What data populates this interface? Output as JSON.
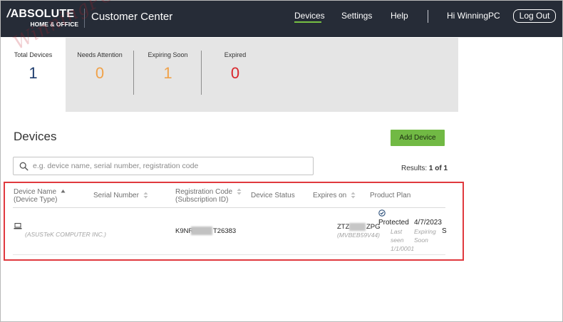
{
  "header": {
    "logo_main": "ABSOLUTE",
    "logo_sub": "HOME & OFFICE",
    "app_title": "Customer Center",
    "nav": {
      "devices": "Devices",
      "settings": "Settings",
      "help": "Help",
      "greeting": "Hi WinningPC",
      "logout": "Log Out"
    },
    "accent_color": "#76c043",
    "bar_color": "#262c37"
  },
  "watermark": "WinningPC",
  "stats": {
    "total": {
      "label": "Total Devices",
      "value": "1",
      "color": "#1f3d6e"
    },
    "needs_attention": {
      "label": "Needs Attention",
      "value": "0",
      "color": "#f0a24a"
    },
    "expiring_soon": {
      "label": "Expiring Soon",
      "value": "1",
      "color": "#f0a24a"
    },
    "expired": {
      "label": "Expired",
      "value": "0",
      "color": "#d9262c"
    }
  },
  "devices": {
    "title": "Devices",
    "add_button": "Add Device",
    "search_placeholder": "e.g. device name, serial number, registration code",
    "results_prefix": "Results: ",
    "results_count": "1 of 1"
  },
  "table": {
    "headers": {
      "device_name": "Device Name",
      "device_type": "(Device Type)",
      "serial_number": "Serial Number",
      "registration_code": "Registration Code",
      "subscription_id": "(Subscription ID)",
      "device_status": "Device Status",
      "expires_on": "Expires on",
      "product_plan": "Product Plan"
    },
    "row": {
      "manufacturer": "(ASUSTeK COMPUTER INC.)",
      "reg_code_start": "K9NR",
      "reg_code_end": "T26383",
      "serial_start": "ZTZ",
      "serial_end": "ZPG",
      "subscription_id": "(MVBEB59V44)",
      "status": "Protected",
      "last_seen": "Last seen 1/1/0001",
      "expires_on": "4/7/2023",
      "expiry_note": "Expiring Soon",
      "plan_truncated": "S"
    }
  }
}
